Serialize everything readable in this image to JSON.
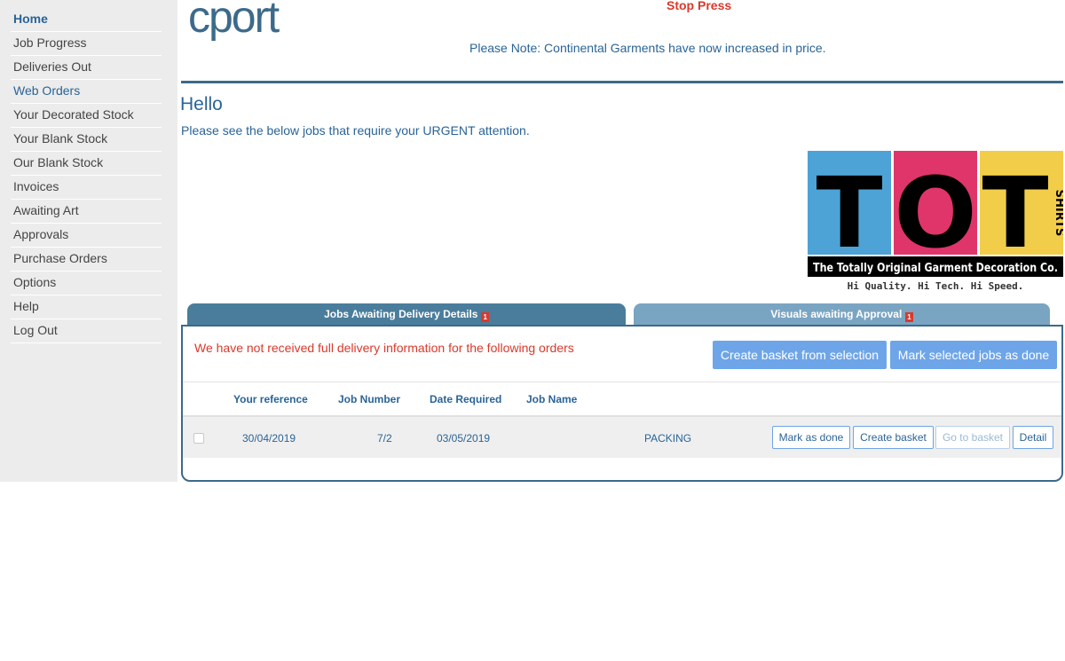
{
  "sidebar": {
    "items": [
      {
        "label": "Home"
      },
      {
        "label": "Job Progress"
      },
      {
        "label": "Deliveries Out"
      },
      {
        "label": "Web Orders"
      },
      {
        "label": "Your Decorated Stock"
      },
      {
        "label": "Your Blank Stock"
      },
      {
        "label": "Our Blank Stock"
      },
      {
        "label": "Invoices"
      },
      {
        "label": "Awaiting Art"
      },
      {
        "label": "Approvals"
      },
      {
        "label": "Purchase Orders"
      },
      {
        "label": "Options"
      },
      {
        "label": "Help"
      },
      {
        "label": "Log Out"
      }
    ]
  },
  "header": {
    "logo_text": "cport",
    "stop_press": "Stop Press",
    "notice": "Please Note: Continental Garments have now increased in price."
  },
  "greeting": {
    "title": "Hello",
    "subtitle": "Please see the below jobs that require your URGENT attention."
  },
  "banner": {
    "letters": [
      "T",
      "O",
      "T"
    ],
    "side_text": "SHIRTS",
    "company": "The Totally Original Garment Decoration Co.",
    "tagline": "Hi Quality.  Hi Tech.  Hi Speed."
  },
  "tabs": [
    {
      "label": "Jobs Awaiting Delivery Details",
      "count": "1"
    },
    {
      "label": "Visuals awaiting Approval",
      "count": "1"
    }
  ],
  "panel": {
    "warning": "We have not received full delivery information for the following orders",
    "create_basket_label": "Create basket from selection",
    "mark_done_label": "Mark selected jobs as done",
    "columns": {
      "ref": "Your reference",
      "job": "Job Number",
      "date": "Date Required",
      "name": "Job Name"
    },
    "rows": [
      {
        "ref": "30/04/2019",
        "job": "7/2",
        "date": "03/05/2019",
        "name": "PACKING",
        "actions": {
          "mark_done": "Mark as done",
          "create_basket": "Create basket",
          "go_basket": "Go to basket",
          "detail": "Detail"
        }
      }
    ]
  },
  "colors": {
    "accent": "#2a6496",
    "alert": "#d9392b",
    "button": "#6ea5e8",
    "tab_active": "#4a7d9b",
    "tab_inactive": "#7aa5c2",
    "banner_blue": "#4da3d6",
    "banner_pink": "#e0356a",
    "banner_yellow": "#f2cd49"
  }
}
